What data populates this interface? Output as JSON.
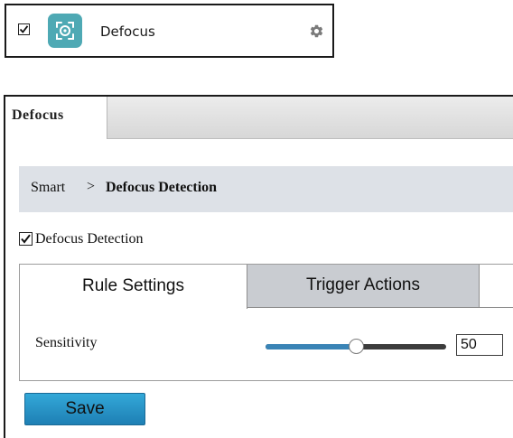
{
  "tile": {
    "checked": true,
    "icon": "defocus-camera-icon",
    "label": "Defocus",
    "settings_icon": "gear-icon"
  },
  "panel": {
    "tab_label": "Defocus",
    "breadcrumb": {
      "root": "Smart",
      "separator": ">",
      "leaf": "Defocus Detection"
    },
    "enable": {
      "checked": true,
      "label": "Defocus Detection"
    },
    "tabs": [
      {
        "label": "Rule Settings",
        "active": true
      },
      {
        "label": "Trigger Actions",
        "active": false
      }
    ],
    "sensitivity": {
      "label": "Sensitivity",
      "value": "50",
      "fraction": 0.5
    },
    "save_label": "Save"
  },
  "colors": {
    "accent": "#4ea9b4",
    "slider_fill": "#3a84b6",
    "save_button": "#2a93c6",
    "breadcrumb_bg": "#dde1e7"
  }
}
